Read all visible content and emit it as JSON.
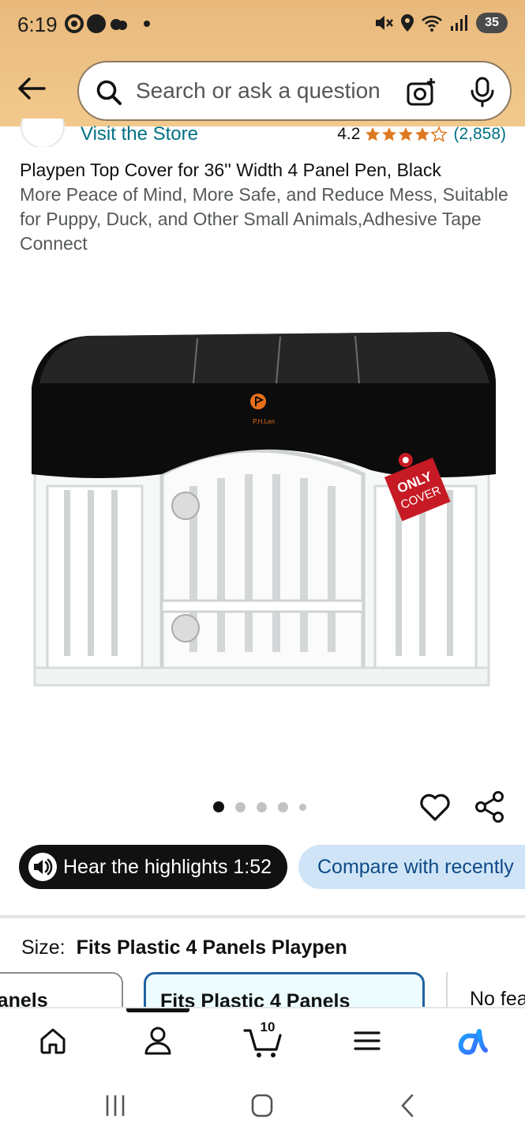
{
  "status_bar": {
    "time": "6:19",
    "battery": "35"
  },
  "header": {
    "search_placeholder": "Search or ask a question"
  },
  "product": {
    "visit_store": "Visit the Store",
    "rating_value": "4.2",
    "rating_stars": 4.2,
    "rating_count": "(2,858)",
    "title_main": "Playpen Top Cover for 36'' Width 4 Panel Pen, Black",
    "title_sub": "More Peace of Mind, More Safe, and Reduce Mess, Suitable for Puppy, Duck, and Other Small Animals,Adhesive Tape Connect",
    "image_brand": "P.H.Len",
    "image_tag_line1": "ONLY",
    "image_tag_line2": "COVER"
  },
  "carousel": {
    "total": 5,
    "active_index": 0
  },
  "actions": {
    "hear_label": "Hear the highlights 1:52",
    "compare_label": "Compare with recently"
  },
  "size": {
    "label": "Size:",
    "value": "Fits Plastic 4 Panels Playpen",
    "options": [
      "Panels",
      "Fits Plastic 4 Panels",
      "No fea"
    ]
  },
  "bottom_nav": {
    "cart_count": "10",
    "items": [
      "home-icon",
      "account-icon",
      "cart-icon",
      "menu-icon",
      "rufus-icon"
    ]
  },
  "colors": {
    "header_bg": "#f2c98c",
    "link": "#007185",
    "star": "#de7921",
    "selected_chip_border": "#2162a1",
    "compare_bg": "#cfe5f7"
  }
}
